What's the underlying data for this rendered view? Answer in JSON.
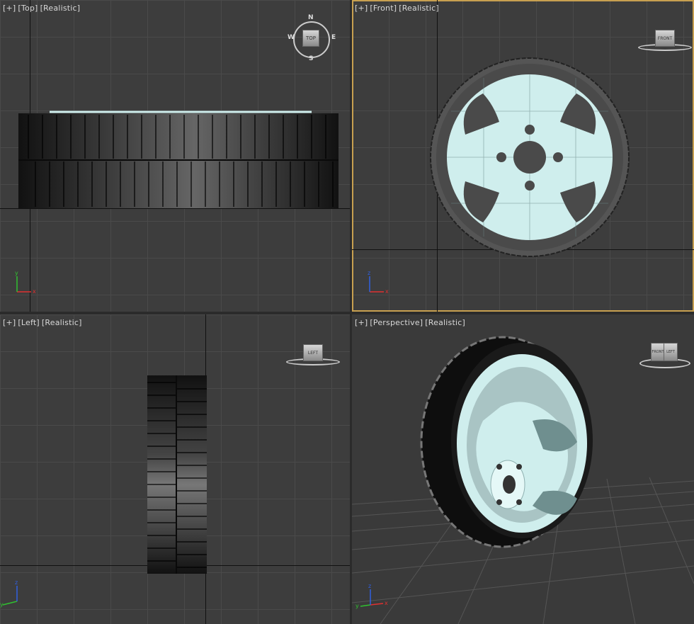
{
  "viewports": {
    "top": {
      "plus": "[+]",
      "view": "[Top]",
      "shading": "[Realistic]",
      "cube_label": "TOP",
      "compass": {
        "n": "N",
        "s": "S",
        "e": "E",
        "w": "W"
      }
    },
    "front": {
      "plus": "[+]",
      "view": "[Front]",
      "shading": "[Realistic]",
      "cube_label": "FRONT"
    },
    "left": {
      "plus": "[+]",
      "view": "[Left]",
      "shading": "[Realistic]",
      "cube_label": "LEFT"
    },
    "perspective": {
      "plus": "[+]",
      "view": "[Perspective]",
      "shading": "[Realistic]",
      "cube_label_a": "FRONT",
      "cube_label_b": "LEFT"
    }
  },
  "axes": {
    "x": "x",
    "y": "y",
    "z": "z"
  },
  "colors": {
    "rim": "#cfeeed",
    "tire": "#222222",
    "tire_side": "#4a4a4a",
    "active_border": "#c8a050",
    "x_axis": "#e03030",
    "y_axis": "#30c030",
    "z_axis": "#3060e0"
  }
}
